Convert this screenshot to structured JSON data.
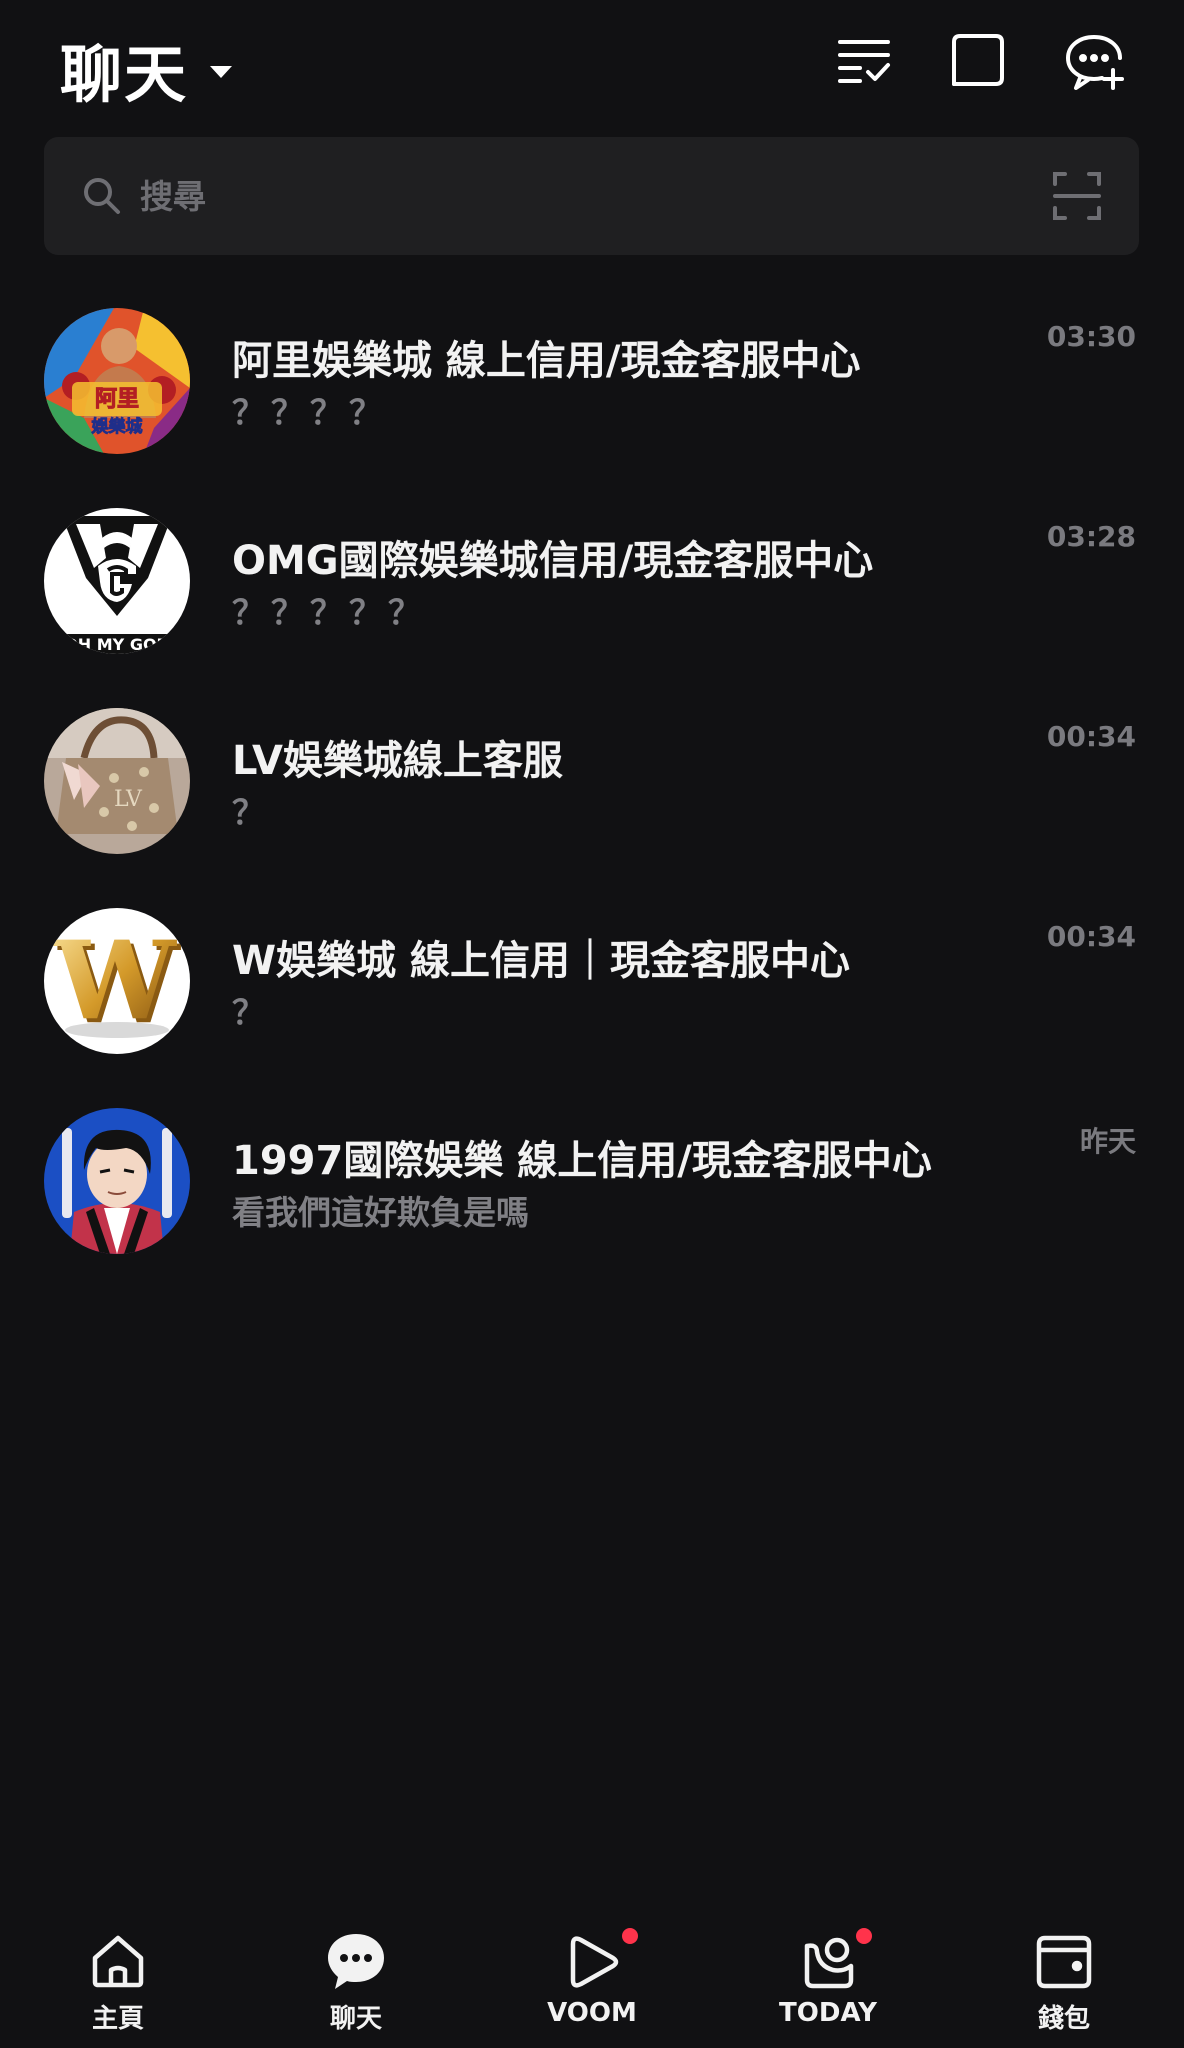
{
  "header": {
    "title": "聊天",
    "icons": [
      "edit-list-icon",
      "square-chat-icon",
      "add-chat-icon"
    ]
  },
  "search": {
    "placeholder": "搜尋"
  },
  "chats": [
    {
      "name": "阿里娛樂城 線上信用/現金客服中心",
      "message": "？？？？",
      "time": "03:30",
      "avatar_text": "阿里\n娛樂城"
    },
    {
      "name": "OMG國際娛樂城信用/現金客服中心",
      "message": "？？？？？",
      "time": "03:28",
      "avatar_text": "OH MY GOD"
    },
    {
      "name": "LV娛樂城線上客服",
      "message": "？",
      "time": "00:34"
    },
    {
      "name": "W娛樂城 線上信用｜現金客服中心",
      "message": "？",
      "time": "00:34",
      "avatar_text": "W"
    },
    {
      "name": "1997國際娛樂 線上信用/現金客服中心",
      "message": "看我們這好欺負是嗎",
      "time": "昨天"
    }
  ],
  "nav": {
    "home": "主頁",
    "chats": "聊天",
    "voom": "VOOM",
    "today": "TODAY",
    "wallet": "錢包"
  },
  "colors": {
    "background": "#111113",
    "search_bg": "#1f1f21",
    "badge_red": "#ff334b",
    "muted_text": "#808085"
  }
}
